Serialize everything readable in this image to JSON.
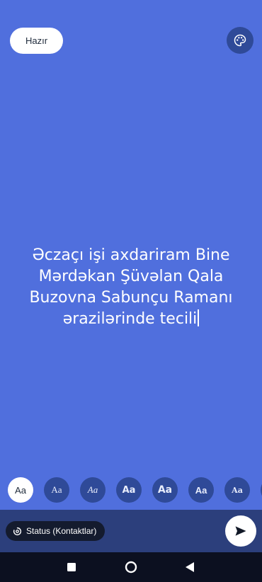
{
  "header": {
    "done_label": "Hazır",
    "palette_icon": "palette-icon"
  },
  "status_text": {
    "value": "Əczaçı işi axdariram Bine Mərdəkan Şüvəlan Qala Buzovna Sabunçu Ramanı ərazilərinde tecili"
  },
  "font_options": [
    {
      "label": "Aa",
      "selected": true
    },
    {
      "label": "Aa",
      "selected": false
    },
    {
      "label": "Aa",
      "selected": false
    },
    {
      "label": "Aa",
      "selected": false
    },
    {
      "label": "Aa",
      "selected": false
    },
    {
      "label": "Aa",
      "selected": false
    },
    {
      "label": "Aa",
      "selected": false
    }
  ],
  "bottom": {
    "audience_label": "Status (Kontaktlar)",
    "audience_icon": "status-icon",
    "send_icon": "send-icon"
  },
  "nav": {
    "recents_icon": "square-icon",
    "home_icon": "circle-icon",
    "back_icon": "triangle-back-icon"
  },
  "colors": {
    "background": "#506fdd",
    "chip": "#2f4a98",
    "bottom_bar": "#2c3f7c",
    "nav_bar": "#0c1020"
  }
}
